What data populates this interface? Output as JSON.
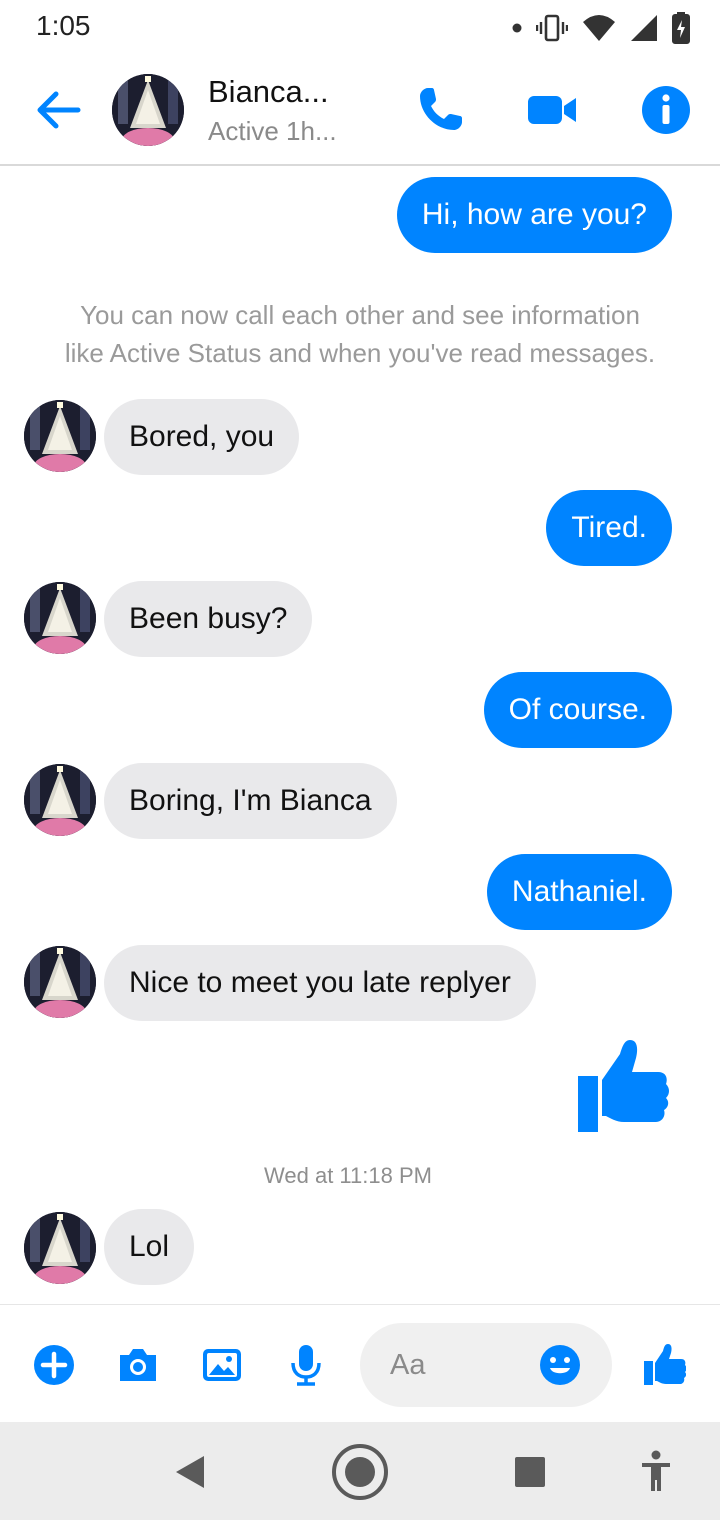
{
  "status_bar": {
    "time": "1:05",
    "icons": [
      "dot-icon",
      "vibrate-icon",
      "wifi-icon",
      "cell-signal-icon",
      "battery-charging-icon"
    ]
  },
  "header": {
    "contact_name": "Bianca...",
    "active_status": "Active 1h...",
    "accent_color": "#0084ff"
  },
  "messages": [
    {
      "direction": "outgoing",
      "text": "Hi, how are you?"
    },
    {
      "type": "notice",
      "text_line1": "You can now call each other and see information",
      "text_line2": "like Active Status and when you've read messages."
    },
    {
      "direction": "incoming",
      "text": "Bored, you"
    },
    {
      "direction": "outgoing",
      "text": "Tired."
    },
    {
      "direction": "incoming",
      "text": "Been busy?"
    },
    {
      "direction": "outgoing",
      "text": "Of course."
    },
    {
      "direction": "incoming",
      "text": "Boring, I'm Bianca"
    },
    {
      "direction": "outgoing",
      "text": "Nathaniel."
    },
    {
      "direction": "incoming",
      "text": "Nice to meet you late replyer"
    },
    {
      "direction": "outgoing",
      "type": "like-sticker"
    },
    {
      "type": "timestamp",
      "text": "Wed at 11:18 PM"
    },
    {
      "direction": "incoming",
      "text": "Lol"
    }
  ],
  "composer": {
    "placeholder": "Aa",
    "icons": [
      "plus-icon",
      "camera-icon",
      "gallery-icon",
      "microphone-icon",
      "emoji-icon",
      "thumbs-up-icon"
    ]
  },
  "nav_bar": {
    "buttons": [
      "back-triangle-icon",
      "home-circle-icon",
      "recents-square-icon",
      "accessibility-icon"
    ]
  }
}
